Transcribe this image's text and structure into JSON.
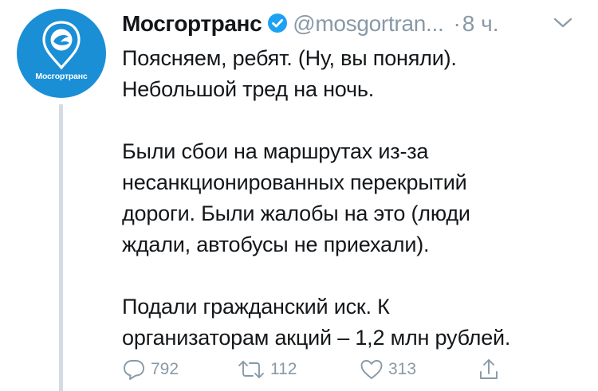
{
  "account": {
    "display_name": "Мосгортранс",
    "handle": "@mosgortran...",
    "separator": "·",
    "time": "8 ч.",
    "avatar_caption": "Мосгортранс",
    "verified": true
  },
  "tweet": {
    "paragraphs": [
      [
        "Поясняем, ребят. (Ну, вы поняли).",
        "Небольшой тред на ночь."
      ],
      [
        "Были сбои на маршрутах из-за",
        "несанкционированных перекрытий",
        "дороги. Были жалобы на это (люди",
        "ждали, автобусы не приехали)."
      ],
      [
        "Подали гражданский иск. К",
        "организаторам акций – 1,2 млн рублей."
      ]
    ]
  },
  "actions": {
    "replies": "792",
    "retweets": "112",
    "likes": "313"
  },
  "colors": {
    "brand_blue": "#1a8fd6",
    "verified_blue": "#1da1f2",
    "muted_gray": "#8899a6",
    "thread_line": "#d3dce3"
  },
  "icons": [
    "chevron-down-icon",
    "verified-badge-icon",
    "reply-icon",
    "retweet-icon",
    "heart-icon",
    "share-icon"
  ]
}
